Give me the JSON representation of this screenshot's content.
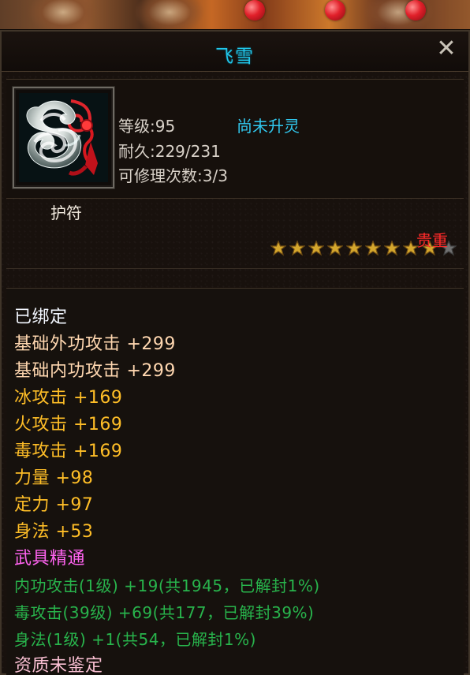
{
  "item": {
    "title": "飞雪",
    "close_label": "✕",
    "level": "等级:95",
    "spirit_status": "尚未升灵",
    "durability": "耐久:229/231",
    "repair_count": "可修理次数:3/3",
    "type": "护符",
    "rarity": "贵重",
    "stars_total": 10,
    "stars_filled": 9
  },
  "attributes": [
    {
      "text": "已绑定",
      "color_key": "pale"
    },
    {
      "text": "基础外功攻击 +299",
      "color_key": "peach"
    },
    {
      "text": "基础内功攻击 +299",
      "color_key": "peach"
    },
    {
      "text": "冰攻击 +169",
      "color_key": "gold"
    },
    {
      "text": "火攻击 +169",
      "color_key": "gold"
    },
    {
      "text": "毒攻击 +169",
      "color_key": "gold"
    },
    {
      "text": "力量 +98",
      "color_key": "gold"
    },
    {
      "text": "定力 +97",
      "color_key": "gold"
    },
    {
      "text": "身法 +53",
      "color_key": "gold"
    },
    {
      "text": "武具精通",
      "color_key": "pink"
    },
    {
      "text": "内功攻击(1级) +19(共1945，已解封1%)",
      "color_key": "green"
    },
    {
      "text": "毒攻击(39级) +69(共177，已解封39%)",
      "color_key": "green"
    },
    {
      "text": "身法(1级) +1(共54，已解封1%)",
      "color_key": "green"
    },
    {
      "text": "资质未鉴定",
      "color_key": "nude"
    }
  ],
  "colors": {
    "title": "#21c7ea",
    "rarity": "#ff2a2a",
    "peach": "#ffd7b0",
    "gold": "#ffbe27",
    "pink": "#ff63f0",
    "green": "#28b44c"
  },
  "icons": {
    "close": "close-icon",
    "item": "jade-cloud-amulet-icon",
    "star_filled": "gold-star-icon",
    "star_empty": "gray-star-icon"
  }
}
